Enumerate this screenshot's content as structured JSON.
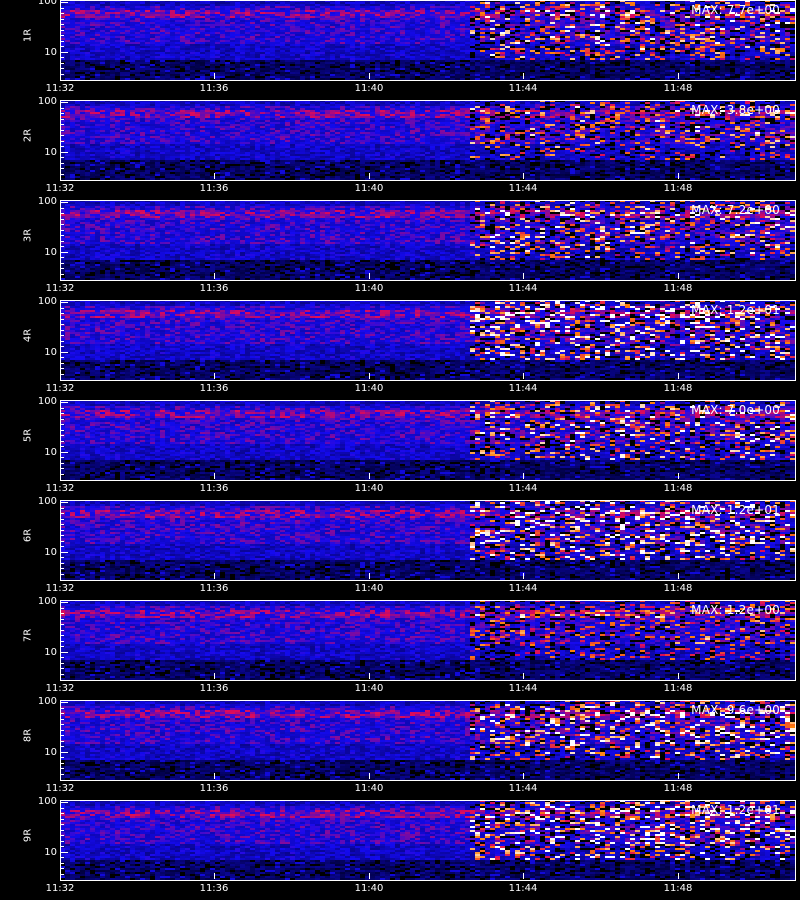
{
  "chart_data": {
    "type": "heatmap",
    "time_ticks": [
      "11:32",
      "11:36",
      "11:40",
      "11:44",
      "11:48"
    ],
    "time_range": [
      "11:32",
      "11:51"
    ],
    "y_scale": "log",
    "y_ticks": [
      "100",
      "10"
    ],
    "colormap": [
      "#000000",
      "#0000ff",
      "#ff0000",
      "#ffff00",
      "#ffffff"
    ],
    "panels": [
      {
        "label": "1R",
        "max_text": "MAX: 7.7e+00",
        "max": 7.7
      },
      {
        "label": "2R",
        "max_text": "MAX: 3.8e+00",
        "max": 3.8
      },
      {
        "label": "3R",
        "max_text": "MAX: 7.2e+00",
        "max": 7.2
      },
      {
        "label": "4R",
        "max_text": "MAX: 1.2e+01",
        "max": 12
      },
      {
        "label": "5R",
        "max_text": "MAX: 7.0e+00",
        "max": 7.0
      },
      {
        "label": "6R",
        "max_text": "MAX: 1.2e+01",
        "max": 12
      },
      {
        "label": "7R",
        "max_text": "MAX: 1.2e+00",
        "max": 1.2
      },
      {
        "label": "8R",
        "max_text": "MAX: 9.6e+00",
        "max": 9.6
      },
      {
        "label": "9R",
        "max_text": "MAX: 1.2e+01",
        "max": 12
      }
    ]
  }
}
